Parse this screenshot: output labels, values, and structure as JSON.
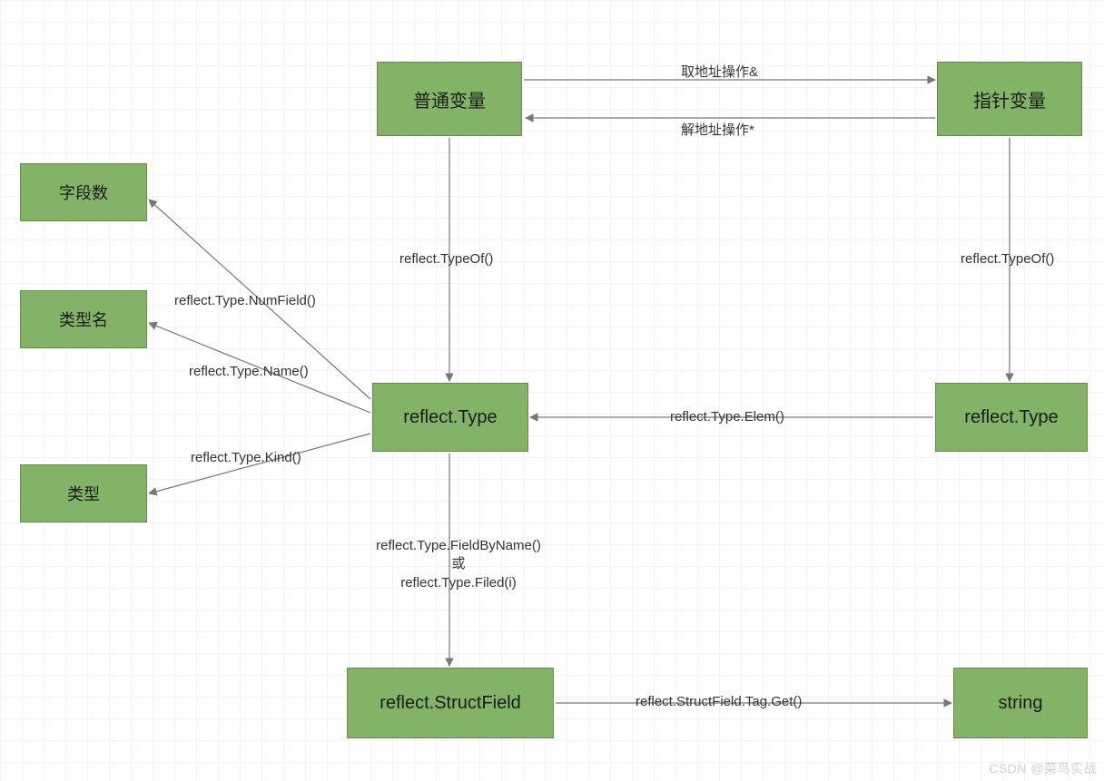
{
  "nodes": {
    "normal_var": {
      "label": "普通变量"
    },
    "pointer_var": {
      "label": "指针变量"
    },
    "field_count": {
      "label": "字段数"
    },
    "type_name": {
      "label": "类型名"
    },
    "kind": {
      "label": "类型"
    },
    "reflect_type_left": {
      "label": "reflect.Type"
    },
    "reflect_type_right": {
      "label": "reflect.Type"
    },
    "struct_field": {
      "label": "reflect.StructField"
    },
    "string": {
      "label": "string"
    }
  },
  "edges": {
    "addr_op": {
      "label": "取地址操作&"
    },
    "deref_op": {
      "label": "解地址操作*"
    },
    "typeof_left": {
      "label": "reflect.TypeOf()"
    },
    "typeof_right": {
      "label": "reflect.TypeOf()"
    },
    "numfield": {
      "label": "reflect.Type.NumField()"
    },
    "name": {
      "label": "reflect.Type.Name()"
    },
    "kind_fn": {
      "label": "reflect.Type.Kind()"
    },
    "elem": {
      "label": "reflect.Type.Elem()"
    },
    "fieldby": {
      "label": "reflect.Type.FieldByName()\n或\nreflect.Type.Filed(i)"
    },
    "tagget": {
      "label": "reflect.StructField.Tag.Get()"
    }
  },
  "watermark": "CSDN @菜鸟实战"
}
